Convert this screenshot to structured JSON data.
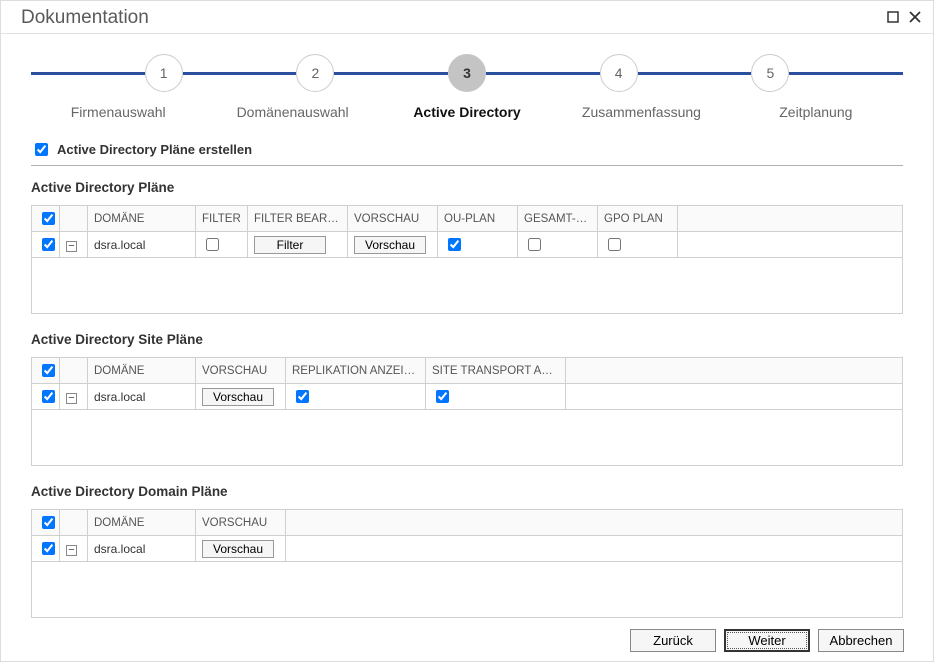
{
  "window": {
    "title": "Dokumentation"
  },
  "stepper": {
    "steps": [
      {
        "num": "1",
        "label": "Firmenauswahl"
      },
      {
        "num": "2",
        "label": "Domänenauswahl"
      },
      {
        "num": "3",
        "label": "Active Directory"
      },
      {
        "num": "4",
        "label": "Zusammenfassung"
      },
      {
        "num": "5",
        "label": "Zeitplanung"
      }
    ],
    "current_index": 2
  },
  "master_checkbox": {
    "label": "Active Directory Pläne erstellen",
    "checked": true
  },
  "sections": {
    "plans": {
      "title": "Active Directory Pläne",
      "headers": {
        "domain": "DOMÄNE",
        "filter": "FILTER",
        "filter_edit": "FILTER BEARBEI...",
        "preview": "VORSCHAU",
        "ou_plan": "OU-PLAN",
        "total_plan": "GESAMT-P...",
        "gpo_plan": "GPO PLAN"
      },
      "rows": [
        {
          "selected": true,
          "domain": "dsra.local",
          "filter_checked": false,
          "filter_btn": "Filter",
          "preview_btn": "Vorschau",
          "ou_checked": true,
          "total_checked": false,
          "gpo_checked": false
        }
      ]
    },
    "site_plans": {
      "title": "Active Directory Site Pläne",
      "headers": {
        "domain": "DOMÄNE",
        "preview": "VORSCHAU",
        "replication": "REPLIKATION ANZEIGEN",
        "site_transport": "SITE TRANSPORT ANZ..."
      },
      "rows": [
        {
          "selected": true,
          "domain": "dsra.local",
          "preview_btn": "Vorschau",
          "replication_checked": true,
          "site_transport_checked": true
        }
      ]
    },
    "domain_plans": {
      "title": "Active Directory Domain Pläne",
      "headers": {
        "domain": "DOMÄNE",
        "preview": "VORSCHAU"
      },
      "rows": [
        {
          "selected": true,
          "domain": "dsra.local",
          "preview_btn": "Vorschau"
        }
      ]
    }
  },
  "footer": {
    "back": "Zurück",
    "next": "Weiter",
    "cancel": "Abbrechen"
  }
}
